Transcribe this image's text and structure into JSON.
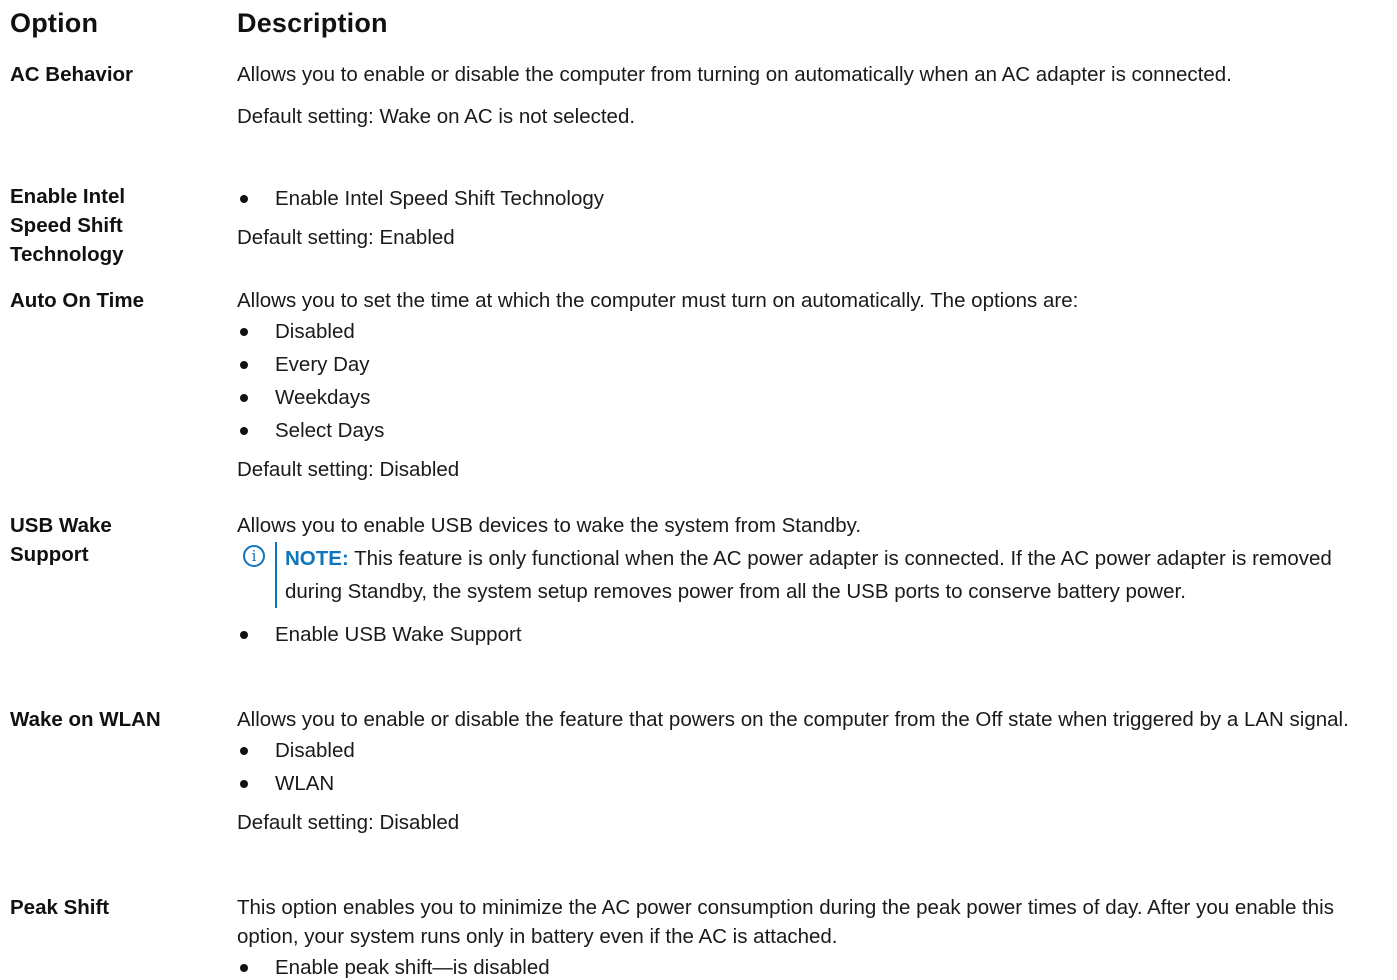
{
  "header": {
    "option": "Option",
    "description": "Description"
  },
  "rows": [
    {
      "name": "AC Behavior",
      "desc": "Allows you to enable or disable the computer from turning on automatically when an AC adapter is connected.",
      "default": "Default setting: Wake on AC is not selected."
    },
    {
      "name": "Enable Intel Speed Shift Technology",
      "bullets": [
        "Enable Intel Speed Shift Technology"
      ],
      "default": "Default setting: Enabled"
    },
    {
      "name": "Auto On Time",
      "desc": "Allows you to set the time at which the computer must turn on automatically. The options are:",
      "bullets": [
        "Disabled",
        "Every Day",
        "Weekdays",
        "Select Days"
      ],
      "default": "Default setting: Disabled"
    },
    {
      "name": "USB Wake Support",
      "desc": "Allows you to enable USB devices to wake the system from Standby.",
      "note_label": "NOTE:",
      "note_text": " This feature is only functional when the AC power adapter is connected. If the AC power adapter is removed during Standby, the system setup removes power from all the USB ports to conserve battery power.",
      "bullets": [
        "Enable USB Wake Support"
      ]
    },
    {
      "name": "Wake on WLAN",
      "desc": "Allows you to enable or disable the feature that powers on the computer from the Off state when triggered by a LAN signal.",
      "bullets": [
        "Disabled",
        "WLAN"
      ],
      "default": "Default setting: Disabled"
    },
    {
      "name": "Peak Shift",
      "desc": "This option enables you to minimize the AC power consumption during the peak power times of day. After you enable this option, your system runs only in battery even if the AC is attached.",
      "bullets": [
        "Enable peak shift—is disabled"
      ]
    }
  ]
}
